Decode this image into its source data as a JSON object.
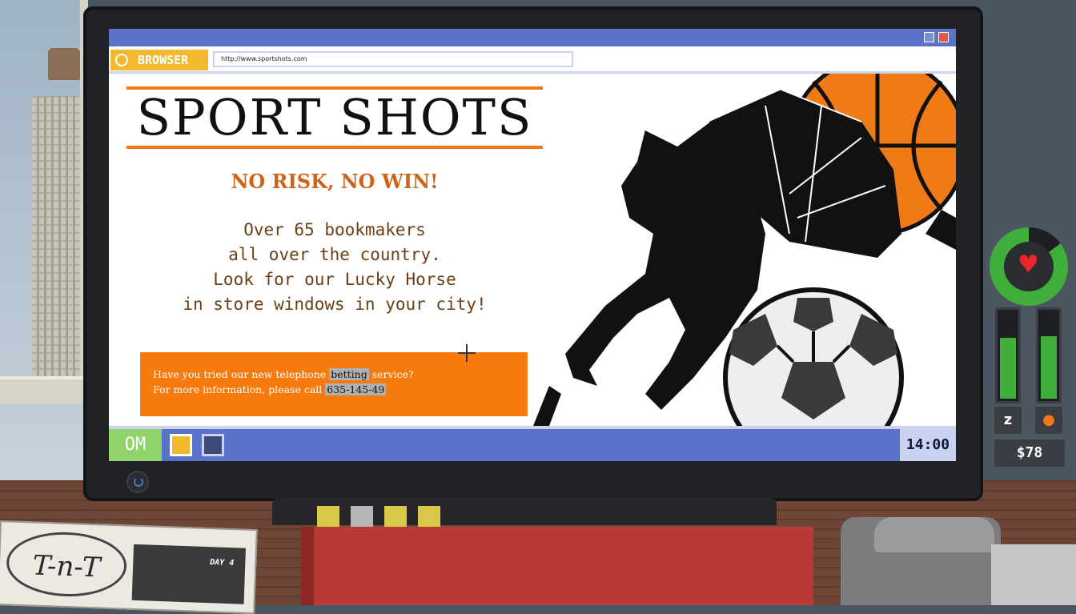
{
  "browser": {
    "tab_label": "BROWSER",
    "url": "http://www.sportshots.com"
  },
  "page": {
    "title": "SPORT SHOTS",
    "slogan": "NO RISK, NO WIN!",
    "description_lines": [
      "Over 65 bookmakers",
      "all over the country.",
      "Look for our Lucky Horse",
      "in store windows in your city!"
    ],
    "promo": {
      "line1_pre": "Have you tried our new telephone ",
      "line1_highlight": "betting",
      "line1_post": " service?",
      "line2_pre": "For more information, please call ",
      "line2_highlight": "635-145-49"
    }
  },
  "taskbar": {
    "start_label": "OM",
    "clock": "14:00"
  },
  "hud": {
    "money": "$78",
    "health_level": 0.85,
    "sleep_level": 0.7,
    "hunger_level": 0.72
  },
  "desk": {
    "newspaper_logo": "T-n-T",
    "newspaper_day": "DAY 4"
  },
  "colors": {
    "accent_orange": "#f67a0d",
    "title_bar_blue": "#5a73c9",
    "hud_green": "#3fae3a"
  }
}
